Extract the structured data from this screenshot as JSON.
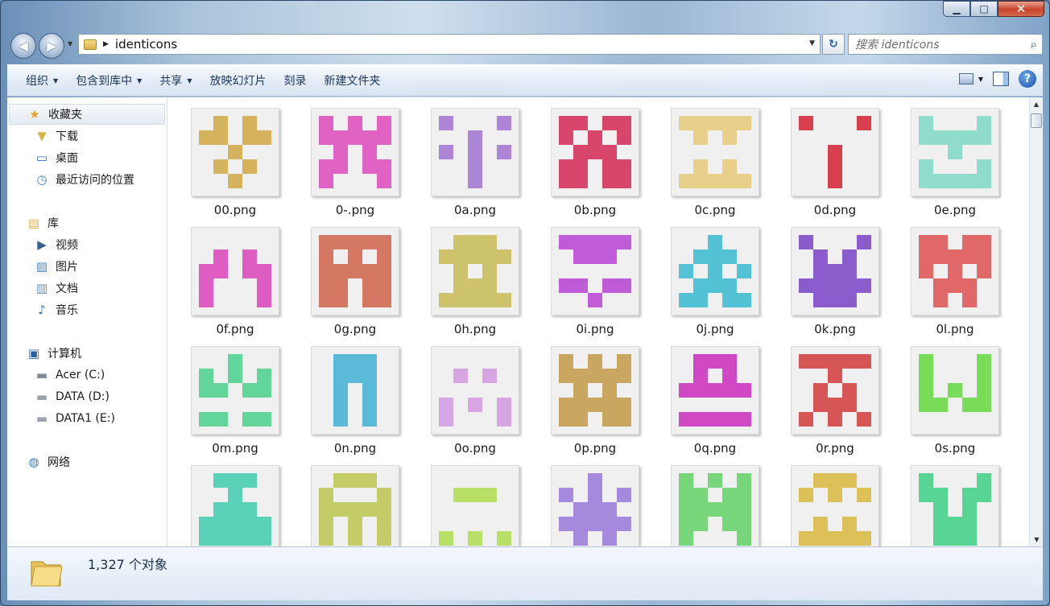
{
  "window": {
    "minimize": "▁",
    "maximize": "□",
    "close": "✕"
  },
  "nav": {
    "back": "◀",
    "forward": "▶"
  },
  "address": {
    "path": "identicons",
    "separator": "▶"
  },
  "search": {
    "placeholder": "搜索 identicons"
  },
  "toolbar": {
    "items": [
      {
        "label": "组织",
        "dropdown": true
      },
      {
        "label": "包含到库中",
        "dropdown": true
      },
      {
        "label": "共享",
        "dropdown": true
      },
      {
        "label": "放映幻灯片",
        "dropdown": false
      },
      {
        "label": "刻录",
        "dropdown": false
      },
      {
        "label": "新建文件夹",
        "dropdown": false
      }
    ],
    "help": "?"
  },
  "sidebar": {
    "favorites": {
      "label": "收藏夹",
      "icon": "star-icon"
    },
    "favorites_items": [
      {
        "label": "下载",
        "icon": "downloads-folder-icon"
      },
      {
        "label": "桌面",
        "icon": "desktop-icon"
      },
      {
        "label": "最近访问的位置",
        "icon": "recent-places-icon"
      }
    ],
    "library": {
      "label": "库",
      "icon": "library-icon"
    },
    "library_items": [
      {
        "label": "视频",
        "icon": "video-library-icon"
      },
      {
        "label": "图片",
        "icon": "pictures-library-icon"
      },
      {
        "label": "文档",
        "icon": "documents-library-icon"
      },
      {
        "label": "音乐",
        "icon": "music-library-icon"
      }
    ],
    "computer": {
      "label": "计算机",
      "icon": "computer-icon"
    },
    "computer_items": [
      {
        "label": "Acer (C:)",
        "icon": "system-drive-icon"
      },
      {
        "label": "DATA (D:)",
        "icon": "drive-icon"
      },
      {
        "label": "DATA1 (E:)",
        "icon": "drive-icon"
      }
    ],
    "network": {
      "label": "网络",
      "icon": "network-icon"
    }
  },
  "files": [
    {
      "name": "00.png",
      "color": "#d4b35c"
    },
    {
      "name": "0-.png",
      "color": "#e063c4"
    },
    {
      "name": "0a.png",
      "color": "#ac85d6"
    },
    {
      "name": "0b.png",
      "color": "#d9466b"
    },
    {
      "name": "0c.png",
      "color": "#e9d08a"
    },
    {
      "name": "0d.png",
      "color": "#d9404f"
    },
    {
      "name": "0e.png",
      "color": "#8fdccb"
    },
    {
      "name": "0f.png",
      "color": "#df5cc2"
    },
    {
      "name": "0g.png",
      "color": "#d47864"
    },
    {
      "name": "0h.png",
      "color": "#cdc36c"
    },
    {
      "name": "0i.png",
      "color": "#c15cd9"
    },
    {
      "name": "0j.png",
      "color": "#53c2d4"
    },
    {
      "name": "0k.png",
      "color": "#8a5ccc"
    },
    {
      "name": "0l.png",
      "color": "#e06868"
    },
    {
      "name": "0m.png",
      "color": "#62d69a"
    },
    {
      "name": "0n.png",
      "color": "#5bbad8"
    },
    {
      "name": "0o.png",
      "color": "#d6a6e3"
    },
    {
      "name": "0p.png",
      "color": "#c9a760"
    },
    {
      "name": "0q.png",
      "color": "#d148c5"
    },
    {
      "name": "0r.png",
      "color": "#d65656"
    },
    {
      "name": "0s.png",
      "color": "#79dc58"
    },
    {
      "name": "",
      "color": "#5ad2b8"
    },
    {
      "name": "",
      "color": "#c3cc66"
    },
    {
      "name": "",
      "color": "#b9e066"
    },
    {
      "name": "",
      "color": "#a489dc"
    },
    {
      "name": "",
      "color": "#78d67a"
    },
    {
      "name": "",
      "color": "#dcc158"
    },
    {
      "name": "",
      "color": "#58d494"
    }
  ],
  "status": {
    "count": "1,327 个对象"
  }
}
